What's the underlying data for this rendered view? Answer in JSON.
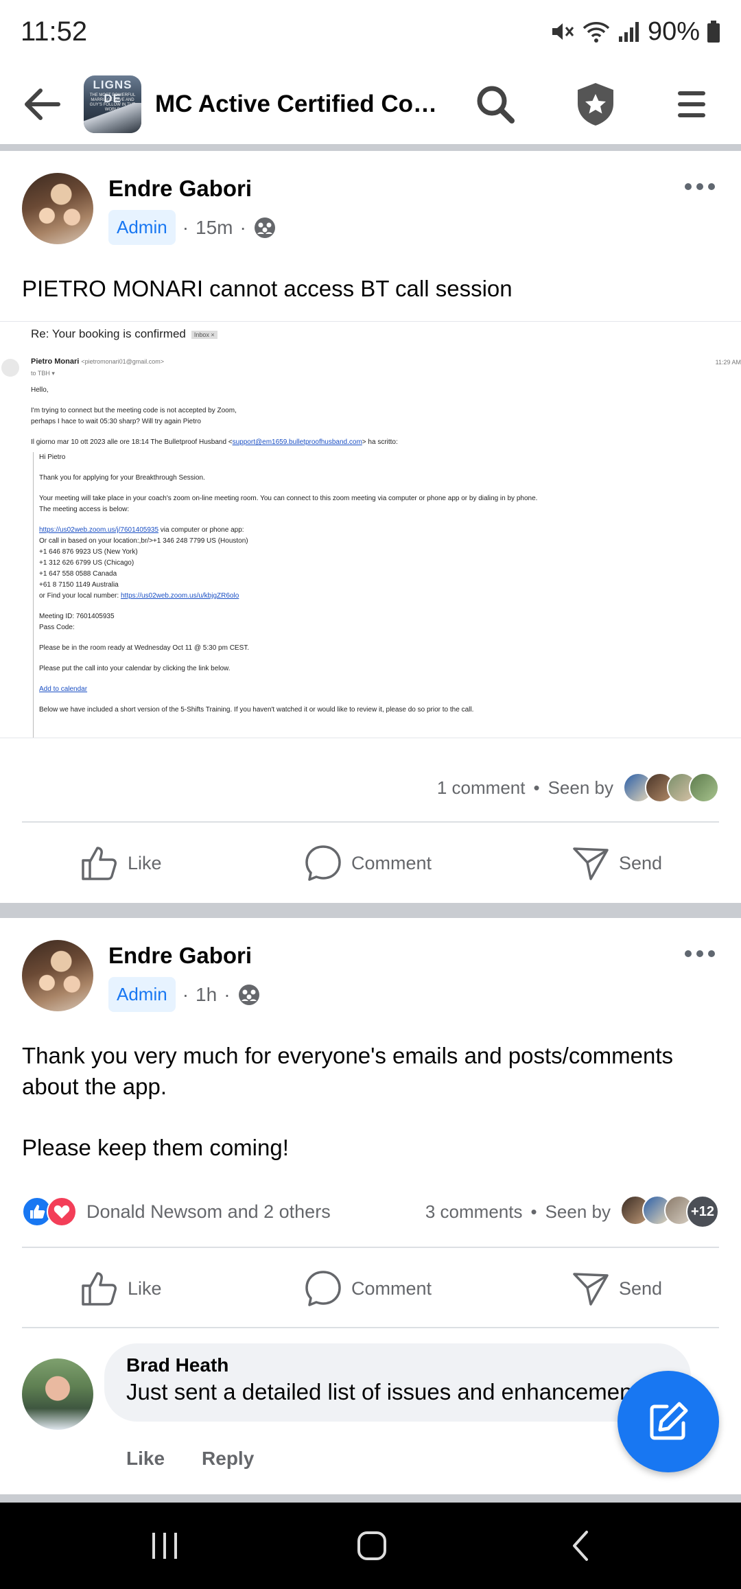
{
  "status_bar": {
    "time": "11:52",
    "battery": "90%"
  },
  "header": {
    "group_title": "MC Active Certified Coa...",
    "thumb_text": "LIGNS DE",
    "thumb_sub": "THE MOST POWERFUL MARRIAGE SAVE AND GUY'S FOLLOW IN THE WORLD"
  },
  "post1": {
    "author": "Endre Gabori",
    "badge": "Admin",
    "time": "15m",
    "text": "PIETRO MONARI cannot access BT call session",
    "email": {
      "subject": "Re: Your booking is confirmed",
      "inbox_tag": "Inbox ×",
      "from_name": "Pietro Monari",
      "from_addr": "<pietromonari01@gmail.com>",
      "to": "to TBH ▾",
      "time": "11:29 AM",
      "body_lines": [
        "Hello,",
        "",
        "I'm trying to connect but the meeting code is not accepted by Zoom,",
        "perhaps I hace to wait 05:30 sharp? Will try again Pietro",
        ""
      ],
      "quote_header_pre": "Il giorno mar 10 ott 2023 alle ore 18:14 The Bulletproof Husband <",
      "quote_header_link": "support@em1659.bulletproofhusband.com",
      "quote_header_post": "> ha scritto:",
      "q1": "Hi Pietro",
      "q2": "Thank you for applying for your Breakthrough Session.",
      "q3": "Your meeting will take place in your coach's zoom on-line meeting room. You can connect to this zoom meeting via computer or phone app or by dialing in by phone.",
      "q4": "The meeting access is below:",
      "q5_link": "https://us02web.zoom.us/j/7601405935",
      "q5_rest": " via computer or phone app:",
      "q6": "Or call in based on your location:,br/>+1 346 248 7799 US (Houston)",
      "q7": "+1 646 876 9923 US (New York)",
      "q8": "+1 312 626 6799 US (Chicago)",
      "q9": "+1 647 558 0588 Canada",
      "q10": "+61 8 7150 1149 Australia",
      "q11_pre": "or Find your local number: ",
      "q11_link": "https://us02web.zoom.us/u/kbjgZR6olo",
      "q12": "Meeting ID: 7601405935",
      "q13": "Pass Code:",
      "q14": "Please be in the room ready at Wednesday Oct 11 @ 5:30 pm CEST.",
      "q15": "Please put the call into your calendar by clicking the link below.",
      "q16_link": "Add to calendar",
      "q17": "Below we have included a short version of the 5-Shifts Training. If you haven't watched it or would like to review it, please do so prior to the call."
    },
    "comments": "1 comment",
    "seen_by": "Seen by"
  },
  "actions": {
    "like": "Like",
    "comment": "Comment",
    "send": "Send"
  },
  "post2": {
    "author": "Endre Gabori",
    "badge": "Admin",
    "time": "1h",
    "text_p1": "Thank you very much for everyone's emails and posts/comments about the app.",
    "text_p2": "Please keep them coming!",
    "reactions": "Donald Newsom and 2 others",
    "comments": "3 comments",
    "seen_by": "Seen by",
    "seen_more": "+12"
  },
  "comment": {
    "name": "Brad Heath",
    "text": "Just sent a detailed list of issues and enhancements",
    "like": "Like",
    "reply": "Reply"
  },
  "colors": {
    "accent": "#1877f2",
    "divider": "#c9ccd1",
    "muted": "#65676b"
  }
}
